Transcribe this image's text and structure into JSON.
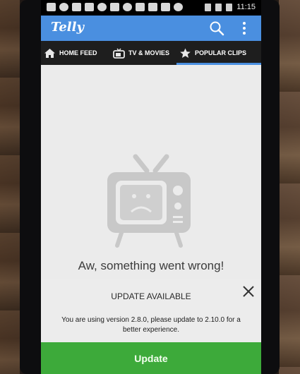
{
  "status_bar": {
    "time": "11:15",
    "icons": [
      "message-icon",
      "notification-icon",
      "facebook-icon",
      "phone-icon",
      "moon-icon",
      "camera-icon",
      "app-icon",
      "facebook-icon",
      "link-icon",
      "photo-icon",
      "app-icon",
      "bluetooth-icon",
      "wifi-icon",
      "battery-icon"
    ]
  },
  "app_bar": {
    "logo": "Telly",
    "search_icon": "search-icon",
    "menu_icon": "overflow-menu-icon",
    "color": "#4a8fe0"
  },
  "tabs": [
    {
      "label": "HOME FEED",
      "icon": "house-icon",
      "active": false
    },
    {
      "label": "TV & MOVIES",
      "icon": "tv-icon",
      "active": false
    },
    {
      "label": "POPULAR CLIPS",
      "icon": "star-icon",
      "active": true
    }
  ],
  "content": {
    "illustration": "sad-tv-icon",
    "error_message": "Aw, something went wrong!"
  },
  "update_banner": {
    "title": "UPDATE AVAILABLE",
    "message": "You are using version 2.8.0, please update to 2.10.0 for a better experience.",
    "button_label": "Update",
    "button_color": "#3daa3a",
    "close_icon": "close-icon"
  }
}
